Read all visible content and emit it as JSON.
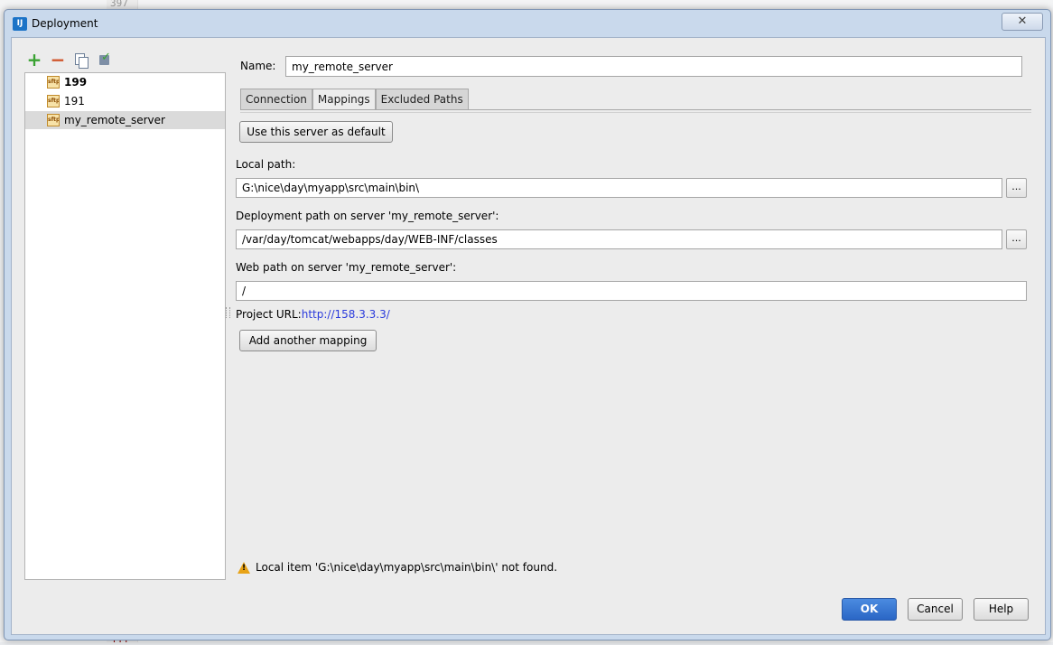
{
  "background": {
    "line_top": "397",
    "line_bottom": "444"
  },
  "window": {
    "title": "Deployment",
    "close_glyph": "✕"
  },
  "toolbar": {
    "add_icon": "plus-icon",
    "remove_icon": "minus-icon",
    "copy_icon": "copy-icon",
    "default_icon": "check-icon",
    "add_glyph": "+",
    "remove_glyph": "−"
  },
  "servers": [
    {
      "name": "199",
      "icon": "sftp-icon",
      "bold": true
    },
    {
      "name": "191",
      "icon": "sftp-icon",
      "bold": false
    },
    {
      "name": "my_remote_server",
      "icon": "sftp-icon",
      "bold": false,
      "selected": true
    }
  ],
  "sftp_icon_text": "sftp",
  "form": {
    "name_label": "Name:",
    "name_value": "my_remote_server"
  },
  "tabs": [
    {
      "label": "Connection"
    },
    {
      "label": "Mappings",
      "active": true
    },
    {
      "label": "Excluded Paths"
    }
  ],
  "mappings": {
    "default_button": "Use this server as default",
    "local_path_label": "Local path:",
    "local_path_value": "G:\\nice\\day\\myapp\\src\\main\\bin\\",
    "deployment_path_label": "Deployment path on server 'my_remote_server':",
    "deployment_path_value": "/var/day/tomcat/webapps/day/WEB-INF/classes",
    "web_path_label": "Web path on server 'my_remote_server':",
    "web_path_value": "/",
    "browse_label": "...",
    "project_url_label": "Project URL:",
    "project_url_value": "http://158.3.3.3/",
    "add_mapping_button": "Add another mapping"
  },
  "warning": {
    "text": "Local item 'G:\\nice\\day\\myapp\\src\\main\\bin\\' not found.",
    "icon": "warning-icon",
    "color": "#e8a317"
  },
  "buttons": {
    "ok": "OK",
    "cancel": "Cancel",
    "help": "Help"
  },
  "colors": {
    "accent": "#2a66c5",
    "link": "#2b3bdc",
    "add": "#3aa232",
    "remove": "#d0542a"
  }
}
